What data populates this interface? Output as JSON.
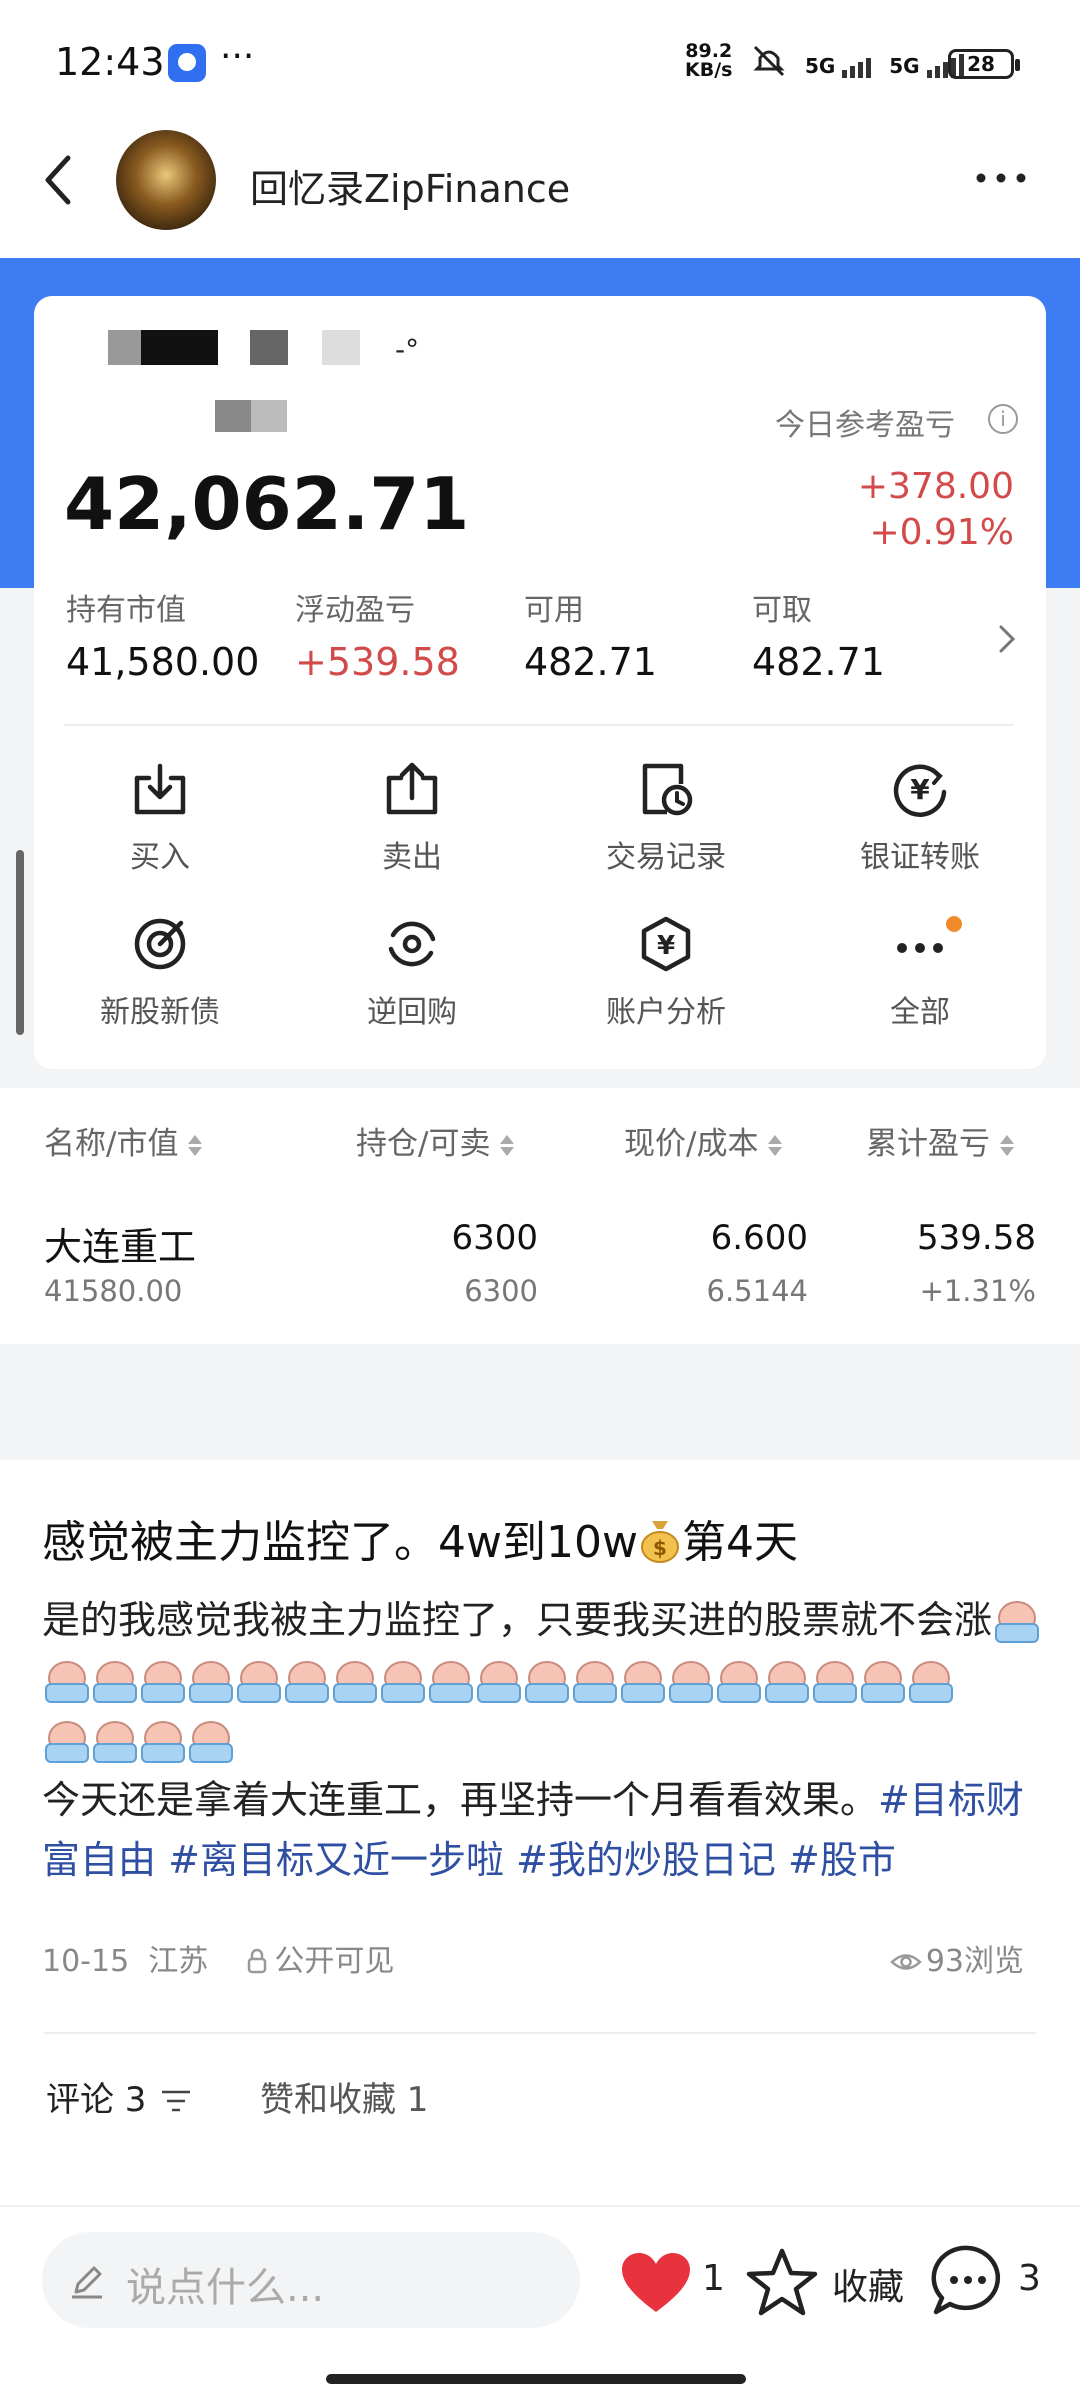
{
  "status_bar": {
    "time": "12:43",
    "dots": "···",
    "speed_top": "89.2",
    "speed_bottom": "KB/s",
    "net1": "5G",
    "net2": "5G",
    "battery": "28"
  },
  "header": {
    "title": "回忆录ZipFinance"
  },
  "account": {
    "masked_tail": "-°",
    "ref_label": "今日参考盈亏",
    "total": "42,062.71",
    "today_pnl": "+378.00",
    "today_pct": "+0.91%",
    "stats": [
      {
        "label": "持有市值",
        "value": "41,580.00"
      },
      {
        "label": "浮动盈亏",
        "value": "+539.58"
      },
      {
        "label": "可用",
        "value": "482.71"
      },
      {
        "label": "可取",
        "value": "482.71"
      }
    ],
    "actions": [
      {
        "label": "买入",
        "icon": "buy-icon"
      },
      {
        "label": "卖出",
        "icon": "sell-icon"
      },
      {
        "label": "交易记录",
        "icon": "trade-record-icon"
      },
      {
        "label": "银证转账",
        "icon": "bank-transfer-icon"
      },
      {
        "label": "新股新债",
        "icon": "ipo-icon"
      },
      {
        "label": "逆回购",
        "icon": "reverse-repo-icon"
      },
      {
        "label": "账户分析",
        "icon": "account-analysis-icon"
      },
      {
        "label": "全部",
        "icon": "more-dots-icon"
      }
    ]
  },
  "holdings": {
    "headers": [
      "名称/市值",
      "持仓/可卖",
      "现价/成本",
      "累计盈亏"
    ],
    "rows": [
      {
        "name": "大连重工",
        "market_value": "41580.00",
        "position": "6300",
        "sellable": "6300",
        "price": "6.600",
        "cost": "6.5144",
        "pnl": "539.58",
        "pnl_pct": "+1.31%"
      }
    ]
  },
  "post": {
    "title_a": "感觉被主力监控了。4w到10w",
    "title_b": "第4天",
    "body1": "是的我感觉我被主力监控了，只要我买进的股票就不会涨",
    "emoji_count_line1": 20,
    "emoji_count_line2": 4,
    "body2": "今天还是拿着大连重工，再坚持一个月看看效果。",
    "tags": [
      "#目标财富自由",
      "#离目标又近一步啦",
      "#我的炒股日记",
      "#股市"
    ],
    "date": "10-15",
    "location": "江苏",
    "visibility": "公开可见",
    "views": "93浏览"
  },
  "tabs": {
    "comments": "评论 3",
    "likes": "赞和收藏 1"
  },
  "bottom_bar": {
    "placeholder": "说点什么...",
    "like_count": "1",
    "collect_label": "收藏",
    "comment_count": "3"
  },
  "colors": {
    "blue": "#3d7cf2",
    "red": "#d24a4a",
    "tag": "#2f4fa3",
    "heart": "#e8333e"
  }
}
